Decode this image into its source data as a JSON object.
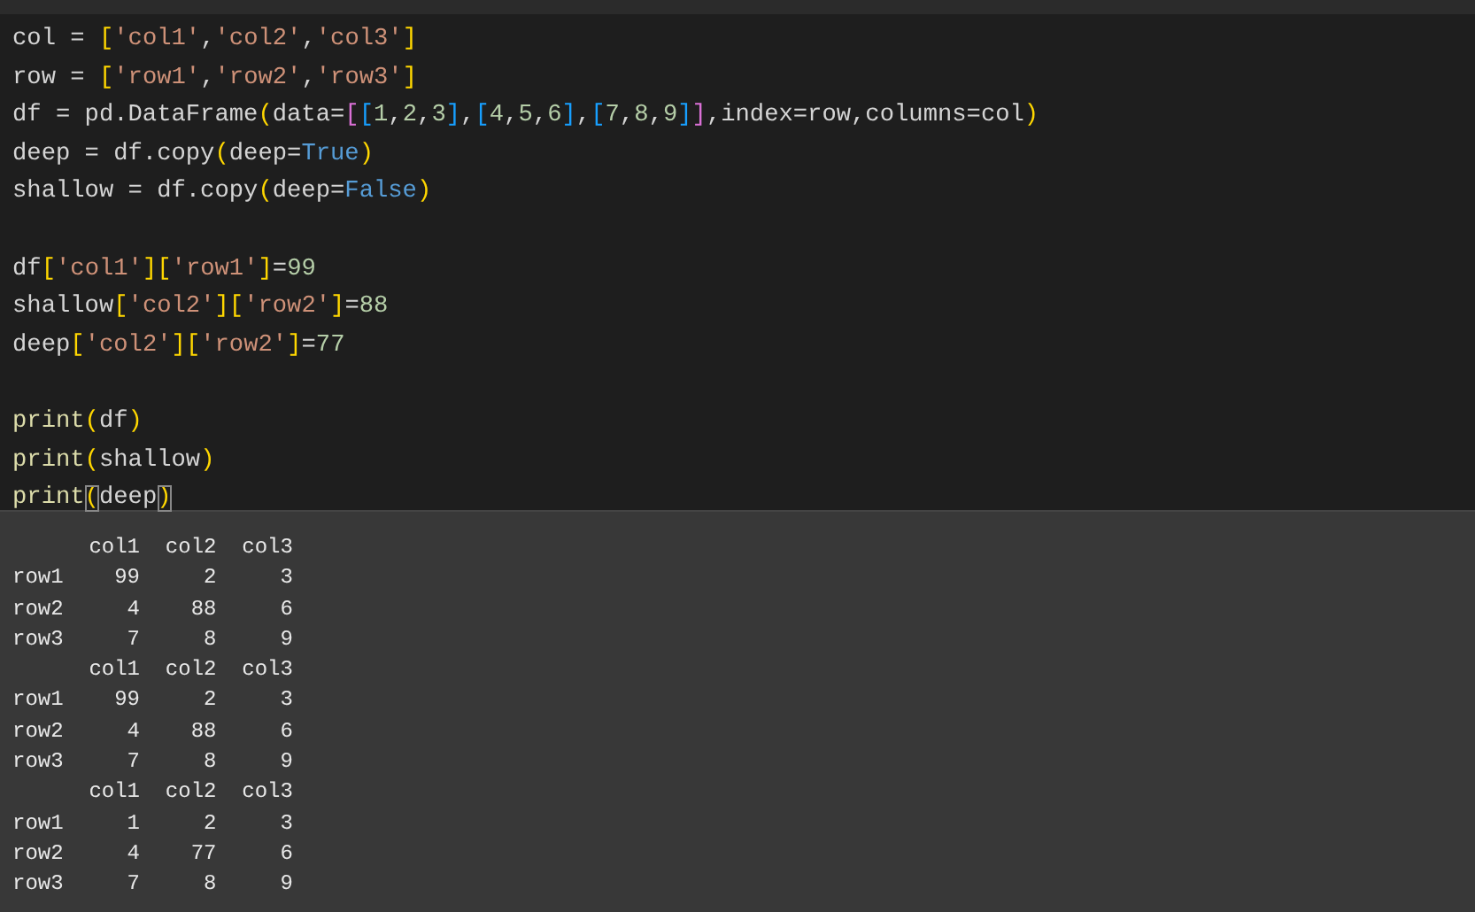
{
  "editor": {
    "lines": [
      {
        "kind": "code",
        "tokens": [
          {
            "t": "col = ",
            "kind": "plain"
          },
          {
            "t": "[",
            "kind": "bracket-gold"
          },
          {
            "t": "'col1'",
            "kind": "string"
          },
          {
            "t": ",",
            "kind": "plain"
          },
          {
            "t": "'col2'",
            "kind": "string"
          },
          {
            "t": ",",
            "kind": "plain"
          },
          {
            "t": "'col3'",
            "kind": "string"
          },
          {
            "t": "]",
            "kind": "bracket-gold"
          }
        ]
      },
      {
        "kind": "code",
        "tokens": [
          {
            "t": "row = ",
            "kind": "plain"
          },
          {
            "t": "[",
            "kind": "bracket-gold"
          },
          {
            "t": "'row1'",
            "kind": "string"
          },
          {
            "t": ",",
            "kind": "plain"
          },
          {
            "t": "'row2'",
            "kind": "string"
          },
          {
            "t": ",",
            "kind": "plain"
          },
          {
            "t": "'row3'",
            "kind": "string"
          },
          {
            "t": "]",
            "kind": "bracket-gold"
          }
        ]
      },
      {
        "kind": "code",
        "tokens": [
          {
            "t": "df = pd.DataFrame",
            "kind": "plain"
          },
          {
            "t": "(",
            "kind": "bracket-gold"
          },
          {
            "t": "data=",
            "kind": "plain"
          },
          {
            "t": "[",
            "kind": "bracket-magenta"
          },
          {
            "t": "[",
            "kind": "bracket-blue"
          },
          {
            "t": "1",
            "kind": "number"
          },
          {
            "t": ",",
            "kind": "plain"
          },
          {
            "t": "2",
            "kind": "number"
          },
          {
            "t": ",",
            "kind": "plain"
          },
          {
            "t": "3",
            "kind": "number"
          },
          {
            "t": "]",
            "kind": "bracket-blue"
          },
          {
            "t": ",",
            "kind": "plain"
          },
          {
            "t": "[",
            "kind": "bracket-blue"
          },
          {
            "t": "4",
            "kind": "number"
          },
          {
            "t": ",",
            "kind": "plain"
          },
          {
            "t": "5",
            "kind": "number"
          },
          {
            "t": ",",
            "kind": "plain"
          },
          {
            "t": "6",
            "kind": "number"
          },
          {
            "t": "]",
            "kind": "bracket-blue"
          },
          {
            "t": ",",
            "kind": "plain"
          },
          {
            "t": "[",
            "kind": "bracket-blue"
          },
          {
            "t": "7",
            "kind": "number"
          },
          {
            "t": ",",
            "kind": "plain"
          },
          {
            "t": "8",
            "kind": "number"
          },
          {
            "t": ",",
            "kind": "plain"
          },
          {
            "t": "9",
            "kind": "number"
          },
          {
            "t": "]",
            "kind": "bracket-blue"
          },
          {
            "t": "]",
            "kind": "bracket-magenta"
          },
          {
            "t": ",index=row,columns=col",
            "kind": "plain"
          },
          {
            "t": ")",
            "kind": "bracket-gold"
          }
        ]
      },
      {
        "kind": "code",
        "tokens": [
          {
            "t": "deep = df.copy",
            "kind": "plain"
          },
          {
            "t": "(",
            "kind": "bracket-gold"
          },
          {
            "t": "deep=",
            "kind": "plain"
          },
          {
            "t": "True",
            "kind": "keyword"
          },
          {
            "t": ")",
            "kind": "bracket-gold"
          }
        ]
      },
      {
        "kind": "code",
        "tokens": [
          {
            "t": "shallow = df.copy",
            "kind": "plain"
          },
          {
            "t": "(",
            "kind": "bracket-gold"
          },
          {
            "t": "deep=",
            "kind": "plain"
          },
          {
            "t": "False",
            "kind": "keyword"
          },
          {
            "t": ")",
            "kind": "bracket-gold"
          }
        ]
      },
      {
        "kind": "blank"
      },
      {
        "kind": "code",
        "tokens": [
          {
            "t": "df",
            "kind": "plain"
          },
          {
            "t": "[",
            "kind": "bracket-gold"
          },
          {
            "t": "'col1'",
            "kind": "string"
          },
          {
            "t": "]",
            "kind": "bracket-gold"
          },
          {
            "t": "[",
            "kind": "bracket-gold"
          },
          {
            "t": "'row1'",
            "kind": "string"
          },
          {
            "t": "]",
            "kind": "bracket-gold"
          },
          {
            "t": "=",
            "kind": "plain"
          },
          {
            "t": "99",
            "kind": "number"
          }
        ]
      },
      {
        "kind": "code",
        "tokens": [
          {
            "t": "shallow",
            "kind": "plain"
          },
          {
            "t": "[",
            "kind": "bracket-gold"
          },
          {
            "t": "'col2'",
            "kind": "string"
          },
          {
            "t": "]",
            "kind": "bracket-gold"
          },
          {
            "t": "[",
            "kind": "bracket-gold"
          },
          {
            "t": "'row2'",
            "kind": "string"
          },
          {
            "t": "]",
            "kind": "bracket-gold"
          },
          {
            "t": "=",
            "kind": "plain"
          },
          {
            "t": "88",
            "kind": "number"
          }
        ]
      },
      {
        "kind": "code",
        "tokens": [
          {
            "t": "deep",
            "kind": "plain"
          },
          {
            "t": "[",
            "kind": "bracket-gold"
          },
          {
            "t": "'col2'",
            "kind": "string"
          },
          {
            "t": "]",
            "kind": "bracket-gold"
          },
          {
            "t": "[",
            "kind": "bracket-gold"
          },
          {
            "t": "'row2'",
            "kind": "string"
          },
          {
            "t": "]",
            "kind": "bracket-gold"
          },
          {
            "t": "=",
            "kind": "plain"
          },
          {
            "t": "77",
            "kind": "number"
          }
        ]
      },
      {
        "kind": "blank"
      },
      {
        "kind": "code",
        "tokens": [
          {
            "t": "print",
            "kind": "function"
          },
          {
            "t": "(",
            "kind": "bracket-gold"
          },
          {
            "t": "df",
            "kind": "plain"
          },
          {
            "t": ")",
            "kind": "bracket-gold"
          }
        ]
      },
      {
        "kind": "code",
        "tokens": [
          {
            "t": "print",
            "kind": "function"
          },
          {
            "t": "(",
            "kind": "bracket-gold"
          },
          {
            "t": "shallow",
            "kind": "plain"
          },
          {
            "t": ")",
            "kind": "bracket-gold"
          }
        ]
      },
      {
        "kind": "code",
        "tokens": [
          {
            "t": "print",
            "kind": "function"
          },
          {
            "t": "(",
            "kind": "bracket-gold",
            "matched": true
          },
          {
            "t": "deep",
            "kind": "plain"
          },
          {
            "t": ")",
            "kind": "bracket-gold",
            "matched": true
          }
        ]
      }
    ]
  },
  "output": {
    "lines": [
      "      col1  col2  col3",
      "row1    99     2     3",
      "row2     4    88     6",
      "row3     7     8     9",
      "      col1  col2  col3",
      "row1    99     2     3",
      "row2     4    88     6",
      "row3     7     8     9",
      "      col1  col2  col3",
      "row1     1     2     3",
      "row2     4    77     6",
      "row3     7     8     9"
    ]
  }
}
